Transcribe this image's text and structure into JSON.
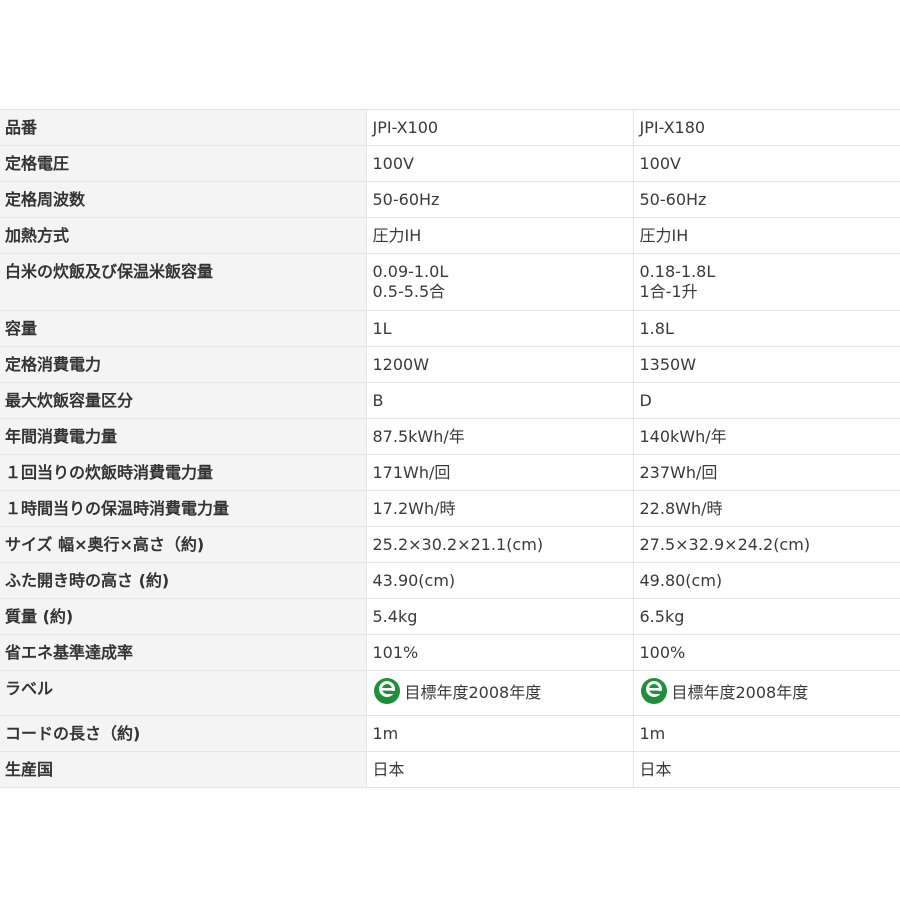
{
  "table": {
    "rows": [
      {
        "label": "品番",
        "a": "JPI-X100",
        "b": "JPI-X180"
      },
      {
        "label": "定格電圧",
        "a": "100V",
        "b": "100V"
      },
      {
        "label": "定格周波数",
        "a": "50-60Hz",
        "b": "50-60Hz"
      },
      {
        "label": "加熱方式",
        "a": "圧力IH",
        "b": "圧力IH"
      },
      {
        "label": "白米の炊飯及び保温米飯容量",
        "a1": "0.09-1.0L",
        "a2": "0.5-5.5合",
        "b1": "0.18-1.8L",
        "b2": "1合-1升"
      },
      {
        "label": "容量",
        "a": "1L",
        "b": "1.8L"
      },
      {
        "label": "定格消費電力",
        "a": "1200W",
        "b": "1350W"
      },
      {
        "label": "最大炊飯容量区分",
        "a": "B",
        "b": "D"
      },
      {
        "label": "年間消費電力量",
        "a": "87.5kWh/年",
        "b": "140kWh/年"
      },
      {
        "label": "１回当りの炊飯時消費電力量",
        "a": "171Wh/回",
        "b": "237Wh/回"
      },
      {
        "label": "１時間当りの保温時消費電力量",
        "a": "17.2Wh/時",
        "b": "22.8Wh/時"
      },
      {
        "label": "サイズ 幅×奥行×高さ（約)",
        "a": "25.2×30.2×21.1(cm)",
        "b": "27.5×32.9×24.2(cm)"
      },
      {
        "label": "ふた開き時の高さ (約)",
        "a": "43.90(cm)",
        "b": "49.80(cm)"
      },
      {
        "label": "質量 (約)",
        "a": "5.4kg",
        "b": "6.5kg"
      },
      {
        "label": "省エネ基準達成率",
        "a": "101%",
        "b": "100%"
      },
      {
        "label": "ラベル",
        "a": "目標年度2008年度",
        "b": "目標年度2008年度",
        "icon": "energy-saving-label-icon",
        "icon_color": "#1f8f3a"
      },
      {
        "label": "コードの長さ（約)",
        "a": "1m",
        "b": "1m"
      },
      {
        "label": "生産国",
        "a": "日本",
        "b": "日本"
      }
    ]
  }
}
